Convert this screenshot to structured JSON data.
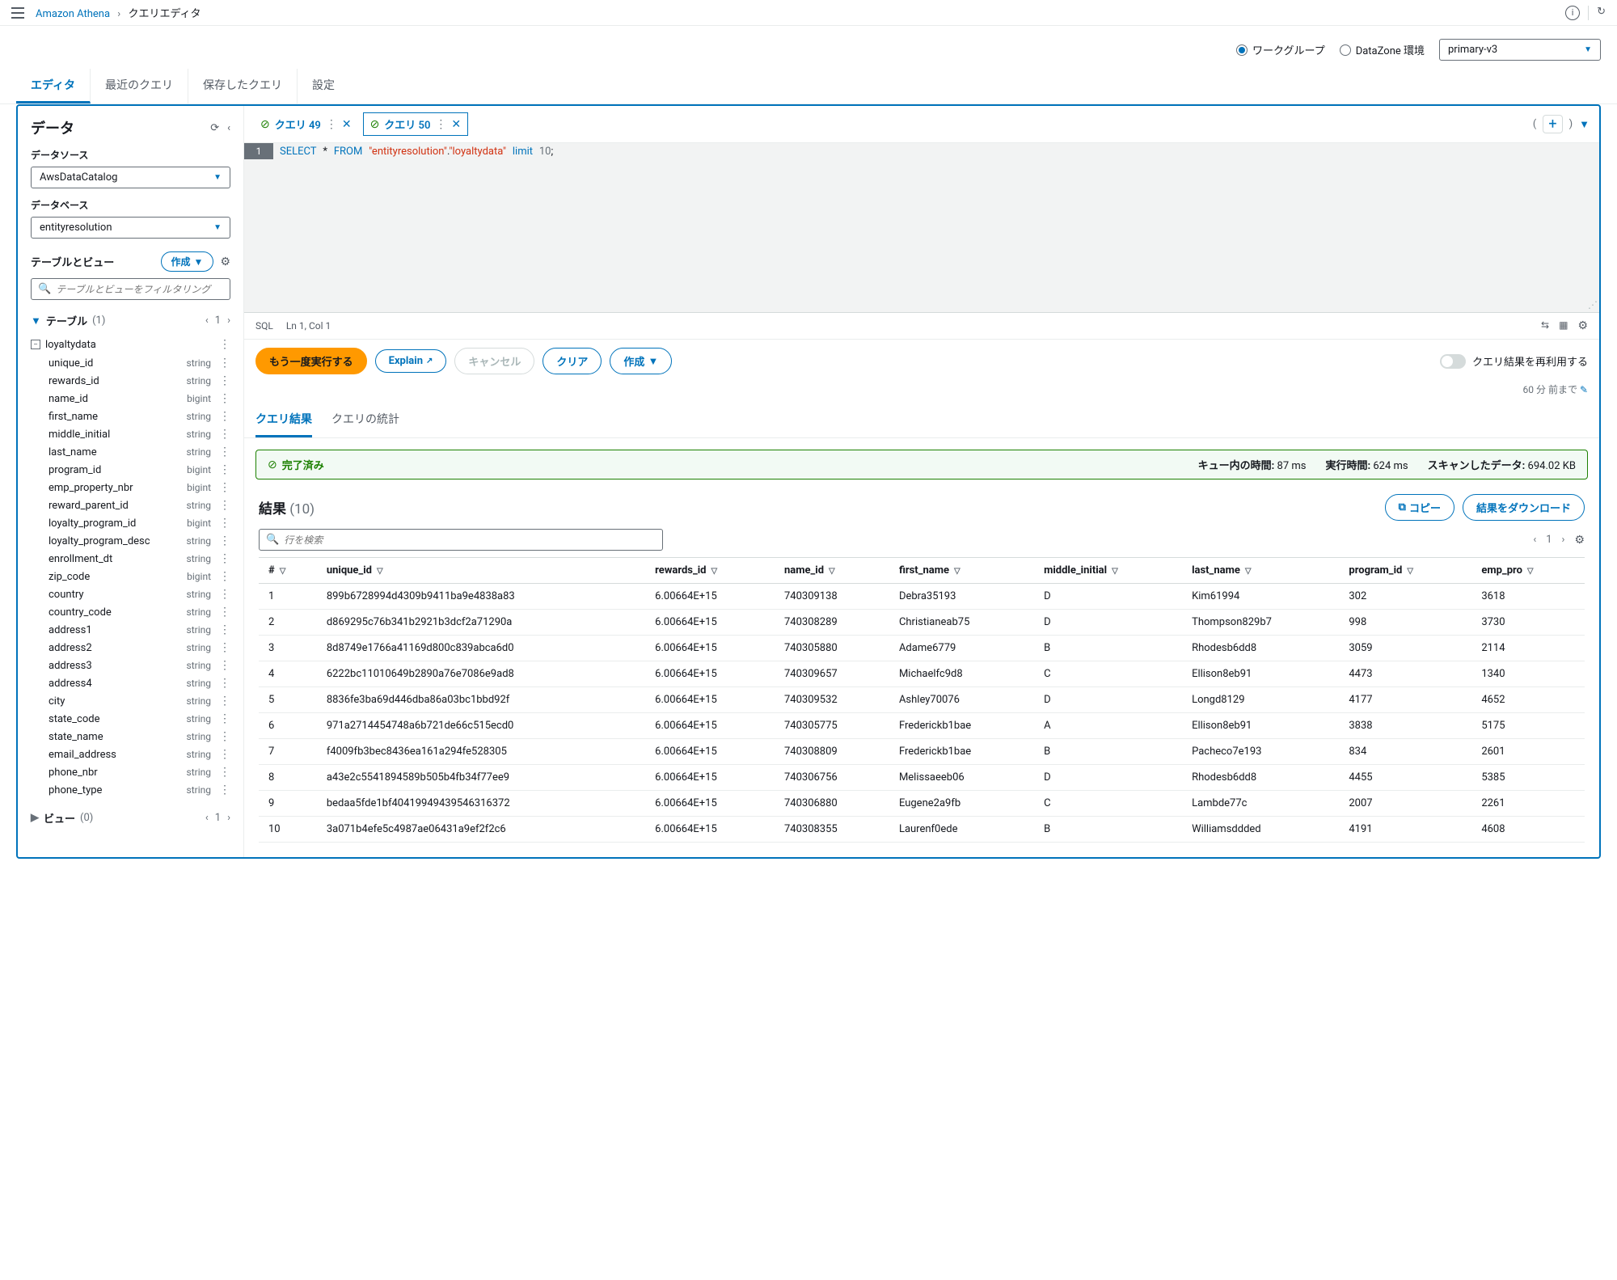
{
  "breadcrumb": {
    "service": "Amazon Athena",
    "page": "クエリエディタ"
  },
  "workgroup": {
    "opt1": "ワークグループ",
    "opt2": "DataZone 環境",
    "selected": "primary-v3"
  },
  "main_tabs": {
    "editor": "エディタ",
    "recent": "最近のクエリ",
    "saved": "保存したクエリ",
    "settings": "設定"
  },
  "sidebar": {
    "title": "データ",
    "datasource_label": "データソース",
    "datasource_value": "AwsDataCatalog",
    "database_label": "データベース",
    "database_value": "entityresolution",
    "tv_title": "テーブルとビュー",
    "create_btn": "作成",
    "filter_placeholder": "テーブルとビューをフィルタリング",
    "tables_label": "テーブル",
    "tables_count": "(1)",
    "page": "1",
    "table_name": "loyaltydata",
    "columns": [
      {
        "n": "unique_id",
        "t": "string"
      },
      {
        "n": "rewards_id",
        "t": "string"
      },
      {
        "n": "name_id",
        "t": "bigint"
      },
      {
        "n": "first_name",
        "t": "string"
      },
      {
        "n": "middle_initial",
        "t": "string"
      },
      {
        "n": "last_name",
        "t": "string"
      },
      {
        "n": "program_id",
        "t": "bigint"
      },
      {
        "n": "emp_property_nbr",
        "t": "bigint"
      },
      {
        "n": "reward_parent_id",
        "t": "string"
      },
      {
        "n": "loyalty_program_id",
        "t": "bigint"
      },
      {
        "n": "loyalty_program_desc",
        "t": "string"
      },
      {
        "n": "enrollment_dt",
        "t": "string"
      },
      {
        "n": "zip_code",
        "t": "bigint"
      },
      {
        "n": "country",
        "t": "string"
      },
      {
        "n": "country_code",
        "t": "string"
      },
      {
        "n": "address1",
        "t": "string"
      },
      {
        "n": "address2",
        "t": "string"
      },
      {
        "n": "address3",
        "t": "string"
      },
      {
        "n": "address4",
        "t": "string"
      },
      {
        "n": "city",
        "t": "string"
      },
      {
        "n": "state_code",
        "t": "string"
      },
      {
        "n": "state_name",
        "t": "string"
      },
      {
        "n": "email_address",
        "t": "string"
      },
      {
        "n": "phone_nbr",
        "t": "string"
      },
      {
        "n": "phone_type",
        "t": "string"
      }
    ],
    "views_label": "ビュー",
    "views_count": "(0)",
    "views_page": "1"
  },
  "query_tabs": {
    "t1": "クエリ 49",
    "t2": "クエリ 50"
  },
  "editor": {
    "line": "1",
    "sql_kw1": "SELECT",
    "sql_star": "*",
    "sql_kw2": "FROM",
    "sql_s1": "\"entityresolution\"",
    "sql_dot": ".",
    "sql_s2": "\"loyaltydata\"",
    "sql_kw3": "limit",
    "sql_num": "10",
    "sql_end": ";"
  },
  "status": {
    "lang": "SQL",
    "pos": "Ln 1, Col 1"
  },
  "actions": {
    "run": "もう一度実行する",
    "explain": "Explain",
    "cancel": "キャンセル",
    "clear": "クリア",
    "create": "作成",
    "reuse_label": "クエリ結果を再利用する",
    "reuse_note": "60 分 前まで"
  },
  "result_tabs": {
    "results": "クエリ結果",
    "stats": "クエリの統計"
  },
  "complete": {
    "label": "完了済み",
    "queue_l": "キュー内の時間:",
    "queue_v": "87 ms",
    "run_l": "実行時間:",
    "run_v": "624 ms",
    "scan_l": "スキャンしたデータ:",
    "scan_v": "694.02 KB"
  },
  "results": {
    "title": "結果",
    "count": "(10)",
    "copy_btn": "コピー",
    "dl_btn": "結果をダウンロード",
    "search_placeholder": "行を検索",
    "page": "1",
    "headers": {
      "num": "#",
      "uid": "unique_id",
      "rid": "rewards_id",
      "nid": "name_id",
      "fn": "first_name",
      "mi": "middle_initial",
      "ln": "last_name",
      "pid": "program_id",
      "ep": "emp_pro"
    },
    "rows": [
      {
        "n": "1",
        "uid": "899b6728994d4309b9411ba9e4838a83",
        "rid": "6.00664E+15",
        "nid": "740309138",
        "fn": "Debra35193",
        "mi": "D",
        "ln": "Kim61994",
        "pid": "302",
        "ep": "3618"
      },
      {
        "n": "2",
        "uid": "d869295c76b341b2921b3dcf2a71290a",
        "rid": "6.00664E+15",
        "nid": "740308289",
        "fn": "Christianeab75",
        "mi": "D",
        "ln": "Thompson829b7",
        "pid": "998",
        "ep": "3730"
      },
      {
        "n": "3",
        "uid": "8d8749e1766a41169d800c839abca6d0",
        "rid": "6.00664E+15",
        "nid": "740305880",
        "fn": "Adame6779",
        "mi": "B",
        "ln": "Rhodesb6dd8",
        "pid": "3059",
        "ep": "2114"
      },
      {
        "n": "4",
        "uid": "6222bc11010649b2890a76e7086e9ad8",
        "rid": "6.00664E+15",
        "nid": "740309657",
        "fn": "Michaelfc9d8",
        "mi": "C",
        "ln": "Ellison8eb91",
        "pid": "4473",
        "ep": "1340"
      },
      {
        "n": "5",
        "uid": "8836fe3ba69d446dba86a03bc1bbd92f",
        "rid": "6.00664E+15",
        "nid": "740309532",
        "fn": "Ashley70076",
        "mi": "D",
        "ln": "Longd8129",
        "pid": "4177",
        "ep": "4652"
      },
      {
        "n": "6",
        "uid": "971a2714454748a6b721de66c515ecd0",
        "rid": "6.00664E+15",
        "nid": "740305775",
        "fn": "Frederickb1bae",
        "mi": "A",
        "ln": "Ellison8eb91",
        "pid": "3838",
        "ep": "5175"
      },
      {
        "n": "7",
        "uid": "f4009fb3bec8436ea161a294fe528305",
        "rid": "6.00664E+15",
        "nid": "740308809",
        "fn": "Frederickb1bae",
        "mi": "B",
        "ln": "Pacheco7e193",
        "pid": "834",
        "ep": "2601"
      },
      {
        "n": "8",
        "uid": "a43e2c5541894589b505b4fb34f77ee9",
        "rid": "6.00664E+15",
        "nid": "740306756",
        "fn": "Melissaeeb06",
        "mi": "D",
        "ln": "Rhodesb6dd8",
        "pid": "4455",
        "ep": "5385"
      },
      {
        "n": "9",
        "uid": "bedaa5fde1bf40419949439546316372",
        "rid": "6.00664E+15",
        "nid": "740306880",
        "fn": "Eugene2a9fb",
        "mi": "C",
        "ln": "Lambde77c",
        "pid": "2007",
        "ep": "2261"
      },
      {
        "n": "10",
        "uid": "3a071b4efe5c4987ae06431a9ef2f2c6",
        "rid": "6.00664E+15",
        "nid": "740308355",
        "fn": "Laurenf0ede",
        "mi": "B",
        "ln": "Williamsddded",
        "pid": "4191",
        "ep": "4608"
      }
    ]
  }
}
